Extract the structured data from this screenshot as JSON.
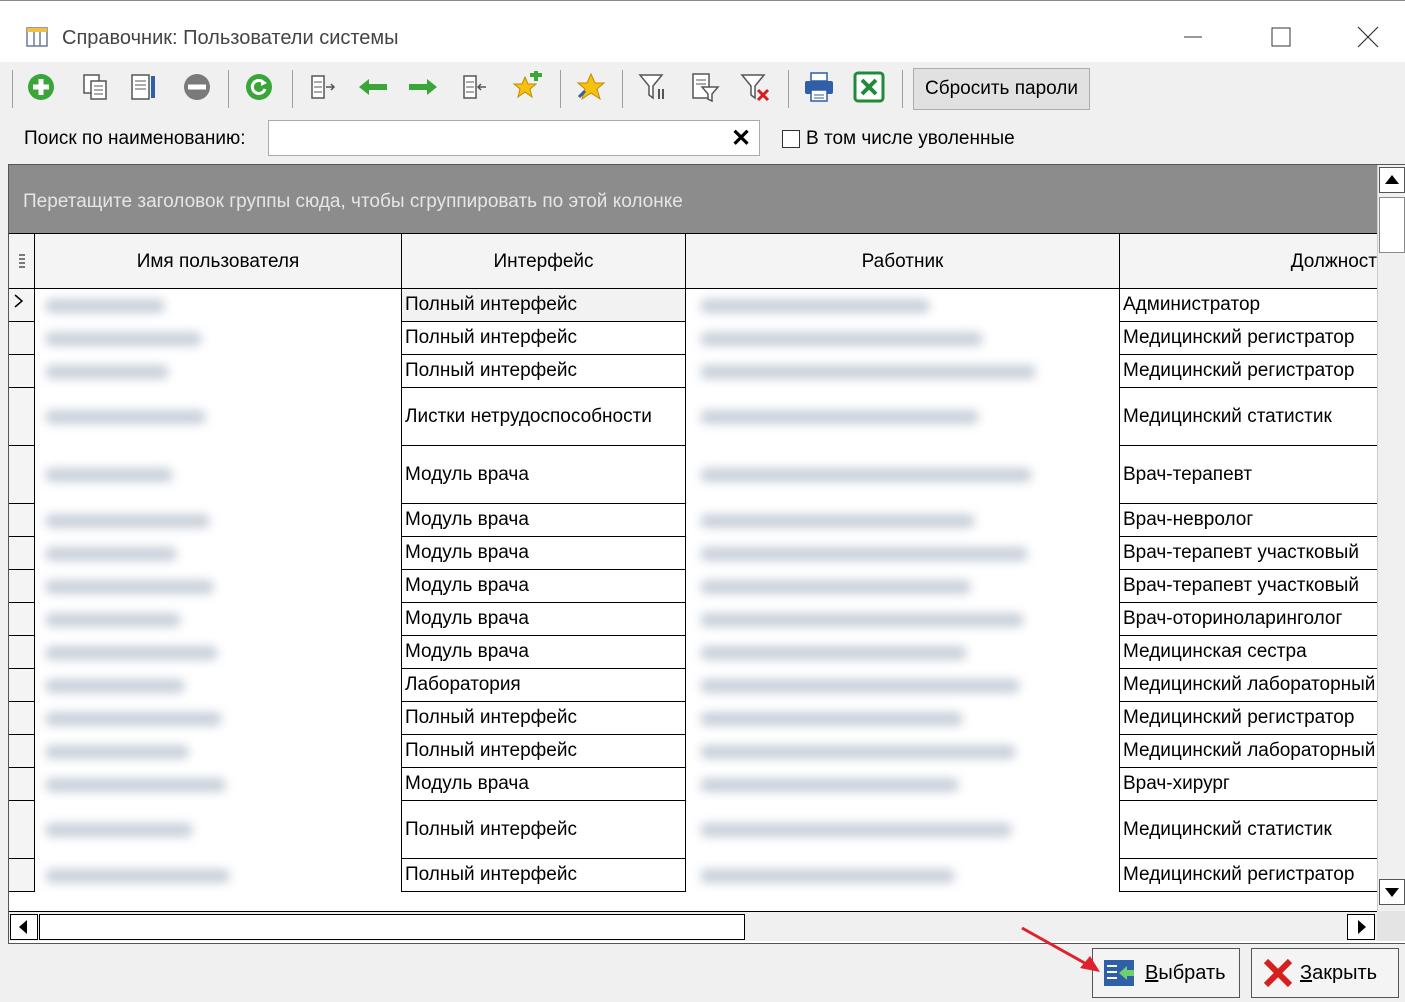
{
  "window": {
    "title": "Справочник: Пользователи системы"
  },
  "toolbar": {
    "icons": [
      "add-icon",
      "copy-icon",
      "edit-icon",
      "delete-icon",
      "refresh-icon",
      "column-chooser-icon",
      "arrow-left-icon",
      "arrow-right-icon",
      "column-settings-icon",
      "favorite-add-icon",
      "favorite-icon",
      "filter-icon",
      "filter-edit-icon",
      "filter-clear-icon",
      "print-icon",
      "excel-export-icon"
    ],
    "reset_passwords_label": "Сбросить пароли"
  },
  "search": {
    "label": "Поиск по наименованию:",
    "value": "",
    "placeholder": "",
    "clear_symbol": "✕",
    "include_fired_label": "В том числе уволенные",
    "include_fired_checked": false
  },
  "grid": {
    "group_panel_hint": "Перетащите заголовок группы сюда, чтобы сгруппировать по этой колонке",
    "columns": [
      "Имя пользователя",
      "Интерфейс",
      "Работник",
      "Должност"
    ],
    "rows": [
      {
        "interface": "Полный интерфейс",
        "position": "Администратор"
      },
      {
        "interface": "Полный интерфейс",
        "position": "Медицинский регистратор"
      },
      {
        "interface": "Полный интерфейс",
        "position": "Медицинский регистратор"
      },
      {
        "interface": "Листки нетрудоспособности",
        "position": "Медицинский статистик"
      },
      {
        "interface": "Модуль врача",
        "position": "Врач-терапевт"
      },
      {
        "interface": "Модуль врача",
        "position": "Врач-невролог"
      },
      {
        "interface": "Модуль врача",
        "position": "Врач-терапевт участковый"
      },
      {
        "interface": "Модуль врача",
        "position": "Врач-терапевт участковый"
      },
      {
        "interface": "Модуль врача",
        "position": "Врач-оториноларинголог"
      },
      {
        "interface": "Модуль врача",
        "position": "Медицинская сестра"
      },
      {
        "interface": "Лаборатория",
        "position": "Медицинский лабораторный"
      },
      {
        "interface": "Полный интерфейс",
        "position": "Медицинский регистратор"
      },
      {
        "interface": "Полный интерфейс",
        "position": "Медицинский лабораторный"
      },
      {
        "interface": "Модуль врача",
        "position": "Врач-хирург"
      },
      {
        "interface": "Полный интерфейс",
        "position": "Медицинский статистик"
      },
      {
        "interface": "Полный интерфейс",
        "position": "Медицинский регистратор"
      }
    ],
    "selected_row_index": 0
  },
  "footer": {
    "select_label": "Выбрать",
    "close_label": "Закрыть"
  },
  "colors": {
    "group_panel_bg": "#8c8c8c",
    "arrow_annotation": "#e0202a",
    "add_green": "#3aa63a",
    "close_red": "#d61f1f"
  }
}
